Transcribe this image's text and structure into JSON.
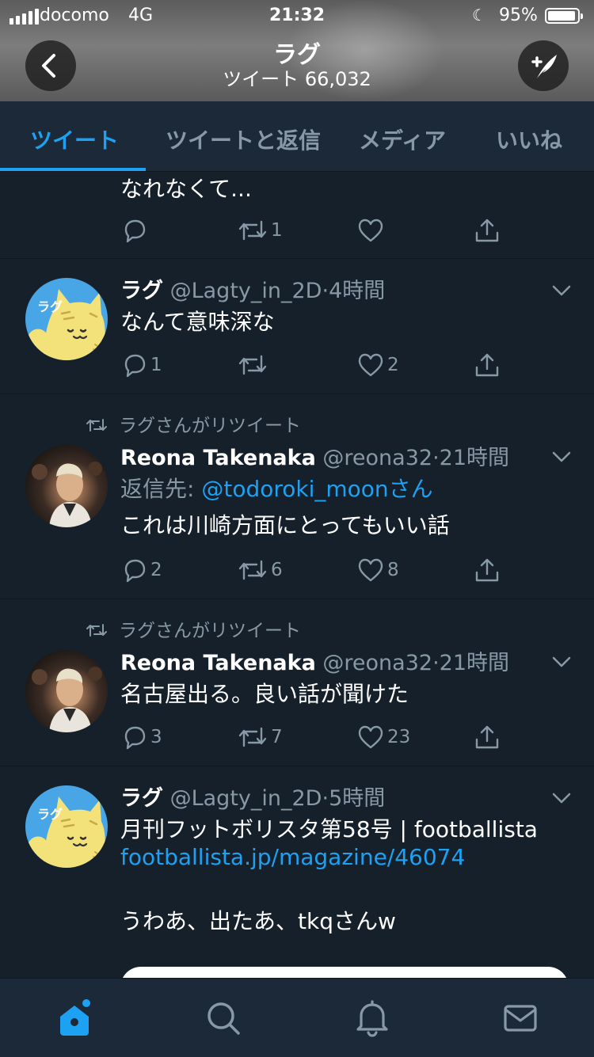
{
  "status_bar": {
    "carrier": "docomo",
    "network": "4G",
    "time": "21:32",
    "battery": "95%",
    "battery_level": 0.95
  },
  "header": {
    "back_icon": "chevron-left-icon",
    "title": "ラグ",
    "tweet_count": "ツイート 66,032",
    "compose_icon": "compose-feather-icon"
  },
  "tabs": [
    {
      "label": "ツイート",
      "active": true
    },
    {
      "label": "ツイートと返信",
      "active": false
    },
    {
      "label": "メディア",
      "active": false
    },
    {
      "label": "いいね",
      "active": false
    }
  ],
  "tweets": [
    {
      "text": [
        "なれなくて..."
      ],
      "replies": "",
      "retweets": "1",
      "likes": ""
    },
    {
      "name": "ラグ",
      "handle": "@Lagty_in_2D",
      "sep": "·",
      "time": "4時間",
      "text": [
        "なんて意味深な"
      ],
      "replies": "1",
      "retweets": "",
      "likes": "2",
      "avatar": "cat-avatar"
    },
    {
      "retweeted_by": "ラグさんがリツイート",
      "name": "Reona Takenaka",
      "handle": "@reona32",
      "sep": "·",
      "time": "21時間",
      "reply_prefix": "返信先: ",
      "reply_mention": "@todoroki_moonさん",
      "text": [
        "これは川崎方面にとってもいい話"
      ],
      "replies": "2",
      "retweets": "6",
      "likes": "8",
      "avatar": "photo-avatar"
    },
    {
      "retweeted_by": "ラグさんがリツイート",
      "name": "Reona Takenaka",
      "handle": "@reona32",
      "sep": "·",
      "time": "21時間",
      "text": [
        "名古屋出る。良い話が聞けた"
      ],
      "replies": "3",
      "retweets": "7",
      "likes": "23",
      "avatar": "photo-avatar"
    },
    {
      "name": "ラグ",
      "handle": "@Lagty_in_2D",
      "sep": "·",
      "time": "5時間",
      "text": [
        "月刊フットボリスタ第58号 | footballista"
      ],
      "link": "footballista.jp/magazine/46074",
      "text2": "うわあ、出たあ、tkqさんw",
      "avatar": "cat-avatar"
    }
  ],
  "bottom_nav": [
    {
      "icon": "home-icon",
      "active": true
    },
    {
      "icon": "search-icon",
      "active": false
    },
    {
      "icon": "notifications-bell-icon",
      "active": false
    },
    {
      "icon": "messages-envelope-icon",
      "active": false
    }
  ],
  "colors": {
    "background": "#15202b",
    "bar": "#1c2938",
    "accent": "#1da1f2",
    "secondary_text": "#8899a6"
  }
}
